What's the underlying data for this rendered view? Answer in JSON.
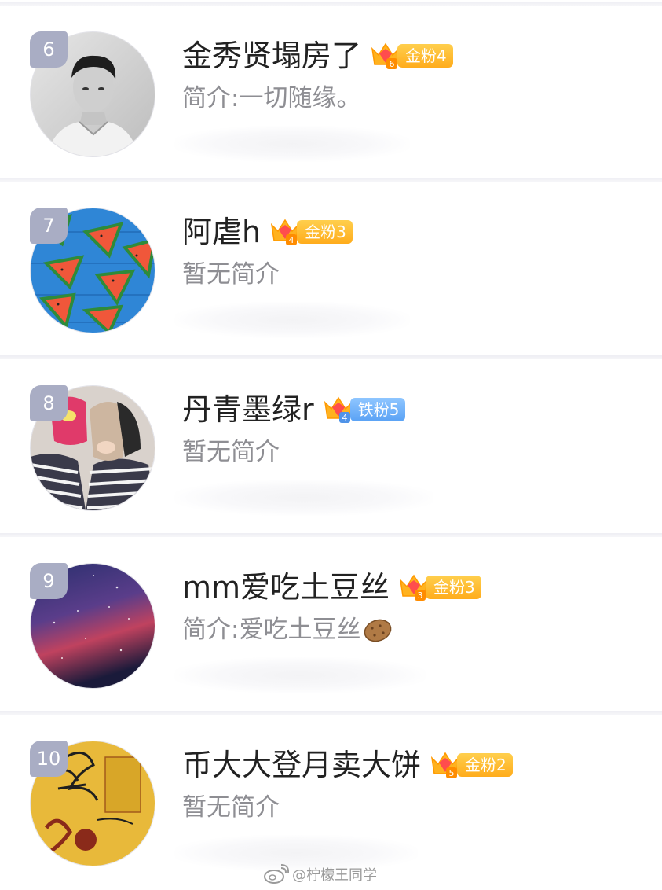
{
  "users": [
    {
      "rank": "6",
      "name": "金秀贤塌房了",
      "badge_level": "6",
      "badge_text": "金粉4",
      "badge_color": "#ffb21f",
      "bio": "简介:一切随缘。"
    },
    {
      "rank": "7",
      "name": "阿虐h",
      "badge_level": "4",
      "badge_text": "金粉3",
      "badge_color": "#ffb21f",
      "bio": "暂无简介"
    },
    {
      "rank": "8",
      "name": "丹青墨绿r",
      "badge_level": "4",
      "badge_text": "铁粉5",
      "badge_color": "#6aaef7",
      "bio": "暂无简介"
    },
    {
      "rank": "9",
      "name": "mm爱吃土豆丝",
      "badge_level": "3",
      "badge_text": "金粉3",
      "badge_color": "#ffb21f",
      "bio": "简介:爱吃土豆丝",
      "bio_emoji": "potato-icon"
    },
    {
      "rank": "10",
      "name": "币大大登月卖大饼",
      "badge_level": "5",
      "badge_text": "金粉2",
      "badge_color": "#ffb21f",
      "bio": "暂无简介"
    }
  ],
  "watermark": {
    "text": "@柠檬王同学",
    "icon": "weibo-icon"
  },
  "colors": {
    "rank_bg": "#a9adc4",
    "name": "#222222",
    "bio": "#8e8e93",
    "separator": "#eeeef3"
  }
}
